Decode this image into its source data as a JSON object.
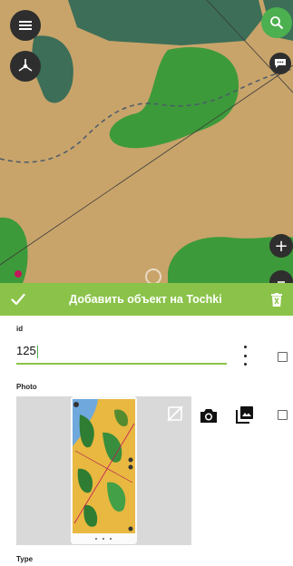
{
  "map": {
    "land_color": "#c8a46a",
    "dark_forest_color": "#3c6e58",
    "forest_color": "#3d9a3a",
    "icons": {
      "menu": "menu-icon",
      "compass": "compass-icon",
      "search": "search-icon",
      "chat": "chat-icon",
      "zoom_in": "plus-icon",
      "zoom_out": "minus-icon"
    },
    "zoom_in_label": "+"
  },
  "action_bar": {
    "title": "Добавить объект на Tochki",
    "background": "#8bc34a",
    "confirm_icon": "check-icon",
    "delete_icon": "trash-icon"
  },
  "form": {
    "id_label": "id",
    "id_value": "125",
    "photo_label": "Photo",
    "type_label": "Type",
    "accent": "#8bc34a",
    "icons": {
      "more": "more-vert-icon",
      "camera": "camera-icon",
      "gallery": "gallery-icon",
      "remove_photo": "remove-photo-icon"
    }
  }
}
